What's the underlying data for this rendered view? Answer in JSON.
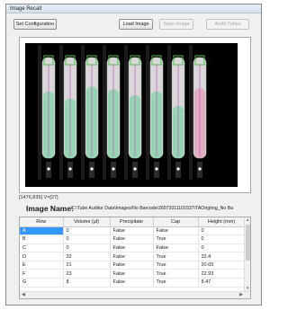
{
  "window": {
    "title": "Image Recall"
  },
  "toolbar": {
    "set_config": "Set Configuration",
    "load_image": "Load Image",
    "save_image": "Save Image",
    "audit_tubes": "Audit Tubes"
  },
  "viewer": {
    "coords_text": "[1476,839]  V=[27]",
    "background_color": "#000000",
    "tube_count": 8,
    "tube_colors": [
      "#7fd6a6",
      "#7fd6a6",
      "#7fd6a6",
      "#7fd6a6",
      "#7fd6a6",
      "#7fd6a6",
      "#7fd6a6",
      "#e3a3b8"
    ]
  },
  "image_name": {
    "label": "Image Name:",
    "value": "C:\\Tube Auditor Data\\Images\\No Barcode\\26072011101537\\TAOrigImg_No Ba"
  },
  "table": {
    "columns": [
      "Row",
      "Volume (µl)",
      "Precipitate",
      "Cap",
      "Height (mm)"
    ],
    "rows": [
      [
        "A",
        "0",
        "False",
        "False",
        "0"
      ],
      [
        "B",
        "0",
        "False",
        "True",
        "0"
      ],
      [
        "C",
        "0",
        "False",
        "False",
        "0"
      ],
      [
        "D",
        "32",
        "False",
        "True",
        "32.4"
      ],
      [
        "E",
        "21",
        "False",
        "True",
        "20.65"
      ],
      [
        "F",
        "23",
        "False",
        "True",
        "22.93"
      ],
      [
        "G",
        "8",
        "False",
        "True",
        "8.47"
      ]
    ],
    "selected_row": 0
  },
  "accent": "#3399ff"
}
